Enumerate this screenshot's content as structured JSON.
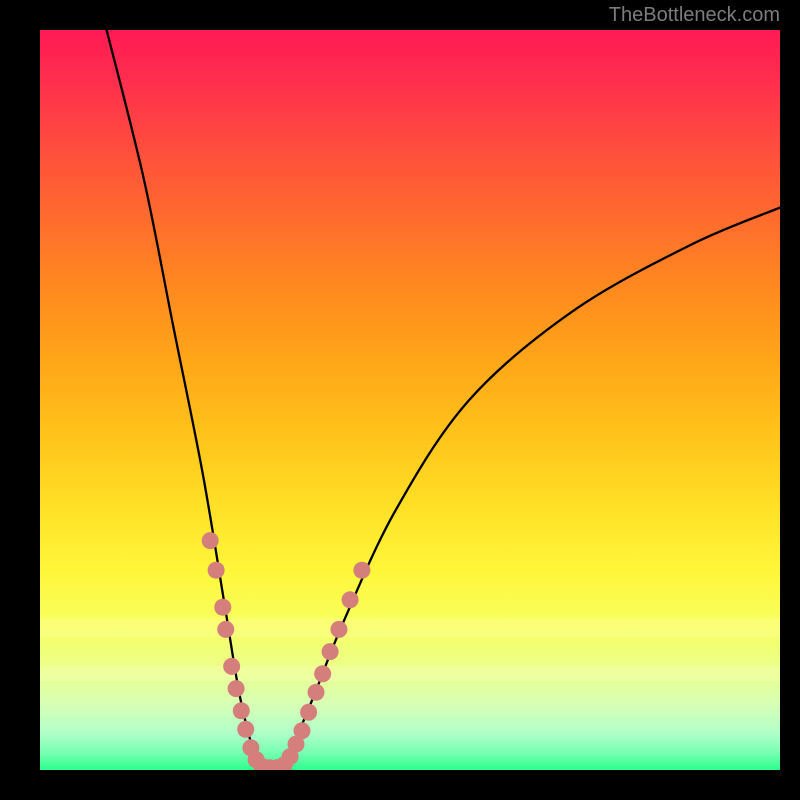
{
  "watermark": "TheBottleneck.com",
  "colors": {
    "dot": "#d57f7c",
    "curve": "#000000",
    "frame": "#000000",
    "gradient_top": "#ff1a55",
    "gradient_bottom": "#2dff8e"
  },
  "chart_data": {
    "type": "line",
    "title": "",
    "xlabel": "",
    "ylabel": "",
    "xlim": [
      0,
      100
    ],
    "ylim": [
      0,
      100
    ],
    "curve": {
      "description": "V-shaped bottleneck curve; minimum at x≈30, y≈0; left branch steeper than right",
      "left_branch": [
        {
          "x": 9,
          "y": 100
        },
        {
          "x": 14,
          "y": 80
        },
        {
          "x": 18,
          "y": 60
        },
        {
          "x": 22,
          "y": 40
        },
        {
          "x": 25,
          "y": 22
        },
        {
          "x": 27,
          "y": 10
        },
        {
          "x": 29,
          "y": 2
        },
        {
          "x": 30,
          "y": 0
        }
      ],
      "right_branch": [
        {
          "x": 30,
          "y": 0
        },
        {
          "x": 32,
          "y": 0
        },
        {
          "x": 34,
          "y": 3
        },
        {
          "x": 37,
          "y": 10
        },
        {
          "x": 41,
          "y": 20
        },
        {
          "x": 48,
          "y": 35
        },
        {
          "x": 58,
          "y": 50
        },
        {
          "x": 72,
          "y": 62
        },
        {
          "x": 88,
          "y": 71
        },
        {
          "x": 100,
          "y": 76
        }
      ]
    },
    "dots": [
      {
        "x": 23.0,
        "y": 31
      },
      {
        "x": 23.8,
        "y": 27
      },
      {
        "x": 24.7,
        "y": 22
      },
      {
        "x": 25.1,
        "y": 19
      },
      {
        "x": 25.9,
        "y": 14
      },
      {
        "x": 26.5,
        "y": 11
      },
      {
        "x": 27.2,
        "y": 8
      },
      {
        "x": 27.8,
        "y": 5.5
      },
      {
        "x": 28.5,
        "y": 3
      },
      {
        "x": 29.2,
        "y": 1.4
      },
      {
        "x": 30.0,
        "y": 0.5
      },
      {
        "x": 31.0,
        "y": 0.3
      },
      {
        "x": 32.0,
        "y": 0.3
      },
      {
        "x": 33.0,
        "y": 0.7
      },
      {
        "x": 33.8,
        "y": 1.8
      },
      {
        "x": 34.6,
        "y": 3.5
      },
      {
        "x": 35.4,
        "y": 5.3
      },
      {
        "x": 36.3,
        "y": 7.8
      },
      {
        "x": 37.3,
        "y": 10.5
      },
      {
        "x": 38.2,
        "y": 13
      },
      {
        "x": 39.2,
        "y": 16
      },
      {
        "x": 40.4,
        "y": 19
      },
      {
        "x": 41.9,
        "y": 23
      },
      {
        "x": 43.5,
        "y": 27
      }
    ]
  }
}
